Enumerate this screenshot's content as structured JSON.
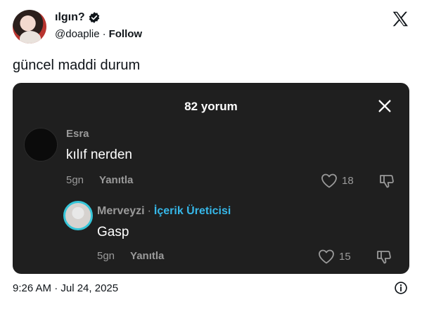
{
  "author": {
    "display_name": "ılgın?",
    "handle": "@doaplie",
    "separator": "·",
    "follow_label": "Follow"
  },
  "tweet": {
    "text": "güncel maddi durum",
    "timestamp": "9:26 AM · Jul 24, 2025"
  },
  "media": {
    "title": "82 yorum",
    "comments": [
      {
        "username": "Esra",
        "text": "kılıf nerden",
        "age": "5gn",
        "reply_label": "Yanıtla",
        "likes": "18"
      },
      {
        "username": "Merveyzi",
        "separator": "·",
        "badge": "İçerik Üreticisi",
        "text": "Gasp",
        "age": "5gn",
        "reply_label": "Yanıtla",
        "likes": "15"
      }
    ]
  },
  "colors": {
    "media_bg": "#1f1f1f",
    "creator_badge": "#36b7e8",
    "avatar_ring": "#35c5d8",
    "verified": "#0f1419"
  },
  "icons": {
    "verified": "verified-badge-icon",
    "brand": "x-logo-icon",
    "close": "close-icon",
    "like": "heart-icon",
    "dislike": "thumbs-down-icon",
    "info": "info-icon"
  }
}
